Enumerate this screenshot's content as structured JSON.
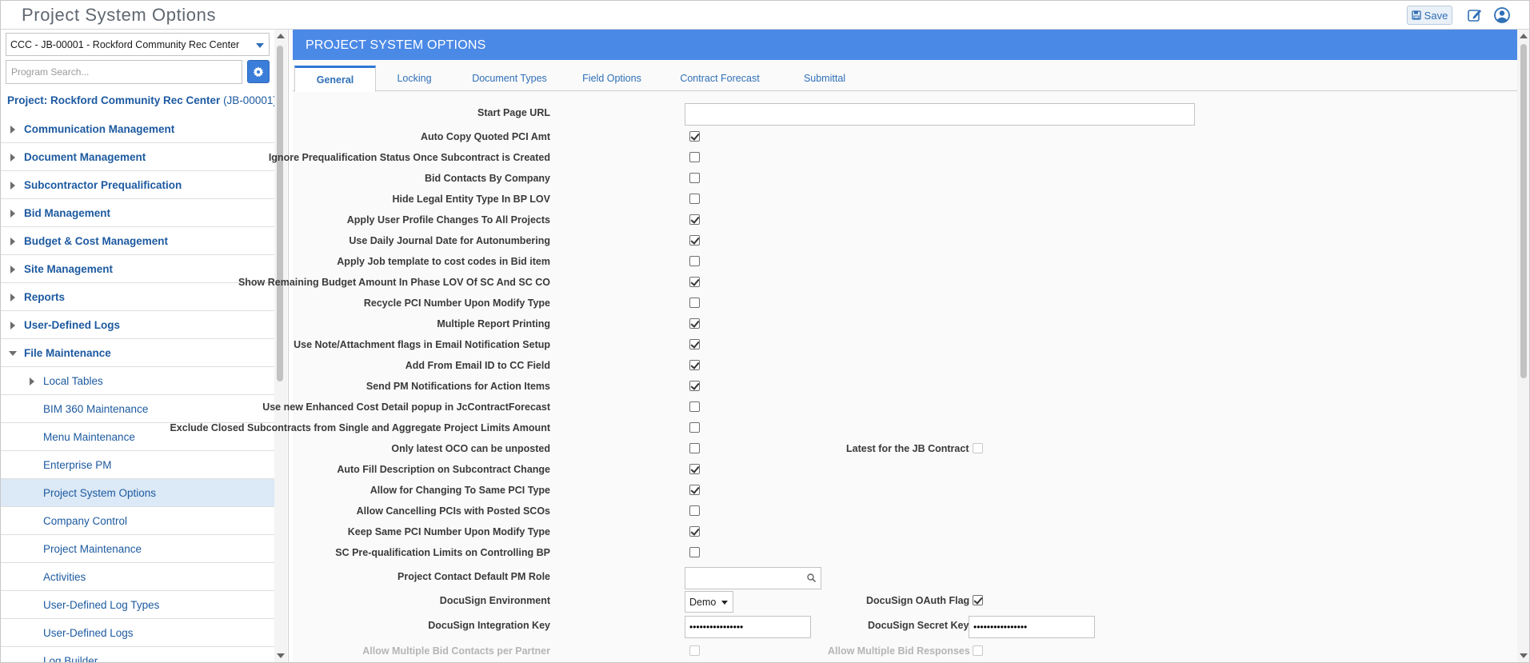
{
  "app": {
    "title": "Project System Options",
    "save_label": "Save"
  },
  "sidebar": {
    "project_select": "CCC - JB-00001 - Rockford Community Rec Center",
    "search_placeholder": "Program Search...",
    "project_heading": "Project: Rockford Community Rec Center",
    "project_code": "(JB-00001)",
    "nav": [
      {
        "label": "Communication Management"
      },
      {
        "label": "Document Management"
      },
      {
        "label": "Subcontractor Prequalification"
      },
      {
        "label": "Bid Management"
      },
      {
        "label": "Budget & Cost Management"
      },
      {
        "label": "Site Management"
      },
      {
        "label": "Reports"
      },
      {
        "label": "User-Defined Logs"
      },
      {
        "label": "File Maintenance"
      }
    ],
    "children": [
      {
        "label": "Local Tables"
      },
      {
        "label": "BIM 360 Maintenance"
      },
      {
        "label": "Menu Maintenance"
      },
      {
        "label": "Enterprise PM"
      },
      {
        "label": "Project System Options"
      },
      {
        "label": "Company Control"
      },
      {
        "label": "Project Maintenance"
      },
      {
        "label": "Activities"
      },
      {
        "label": "User-Defined Log Types"
      },
      {
        "label": "User-Defined Logs"
      },
      {
        "label": "Log Builder"
      }
    ]
  },
  "main": {
    "header": "PROJECT SYSTEM OPTIONS",
    "tabs": [
      {
        "label": "General"
      },
      {
        "label": "Locking"
      },
      {
        "label": "Document Types"
      },
      {
        "label": "Field Options"
      },
      {
        "label": "Contract Forecast"
      },
      {
        "label": "Submittal"
      }
    ],
    "fields": {
      "start_page_url": {
        "label": "Start Page URL",
        "value": ""
      },
      "checks": [
        {
          "label": "Auto Copy Quoted PCI Amt",
          "checked": true
        },
        {
          "label": "Ignore Prequalification Status Once Subcontract is Created",
          "checked": false
        },
        {
          "label": "Bid Contacts By Company",
          "checked": false
        },
        {
          "label": "Hide Legal Entity Type In BP LOV",
          "checked": false
        },
        {
          "label": "Apply User Profile Changes To All Projects",
          "checked": true
        },
        {
          "label": "Use Daily Journal Date for Autonumbering",
          "checked": true
        },
        {
          "label": "Apply Job template to cost codes in Bid item",
          "checked": false
        },
        {
          "label": "Show Remaining Budget Amount In Phase LOV Of SC And SC CO",
          "checked": true
        },
        {
          "label": "Recycle PCI Number Upon Modify Type",
          "checked": false
        },
        {
          "label": "Multiple Report Printing",
          "checked": true
        },
        {
          "label": "Use Note/Attachment flags in Email Notification Setup",
          "checked": true
        },
        {
          "label": "Add From Email ID to CC Field",
          "checked": true
        },
        {
          "label": "Send PM Notifications for Action Items",
          "checked": true
        },
        {
          "label": "Use new Enhanced Cost Detail popup in JcContractForecast",
          "checked": false
        },
        {
          "label": "Exclude Closed Subcontracts from Single and Aggregate Project Limits Amount",
          "checked": false
        },
        {
          "label": "Only latest OCO can be unposted",
          "checked": false
        },
        {
          "label": "Auto Fill Description on Subcontract Change",
          "checked": true
        },
        {
          "label": "Allow for Changing To Same PCI Type",
          "checked": true
        },
        {
          "label": "Allow Cancelling PCIs with Posted SCOs",
          "checked": false
        },
        {
          "label": "Keep Same PCI Number Upon Modify Type",
          "checked": true
        },
        {
          "label": "SC Pre-qualification Limits on Controlling BP",
          "checked": false
        }
      ],
      "latest_jb_contract": {
        "label": "Latest for the JB Contract",
        "checked": false
      },
      "pm_role": {
        "label": "Project Contact Default PM Role",
        "value": ""
      },
      "docusign_env": {
        "label": "DocuSign Environment",
        "value": "Demo"
      },
      "docusign_oauth": {
        "label": "DocuSign OAuth Flag",
        "checked": true
      },
      "docusign_key": {
        "label": "DocuSign Integration Key",
        "value": "••••••••••••••••"
      },
      "docusign_secret": {
        "label": "DocuSign Secret Key",
        "value": "••••••••••••••••"
      },
      "multi_bid_contacts": {
        "label": "Allow Multiple Bid Contacts per Partner",
        "checked": false
      },
      "multi_bid_responses": {
        "label": "Allow Multiple Bid Responses",
        "checked": false
      }
    }
  },
  "colors": {
    "accent": "#4b89e6",
    "link": "#1d5aa0",
    "selected": "#dce9f6"
  }
}
